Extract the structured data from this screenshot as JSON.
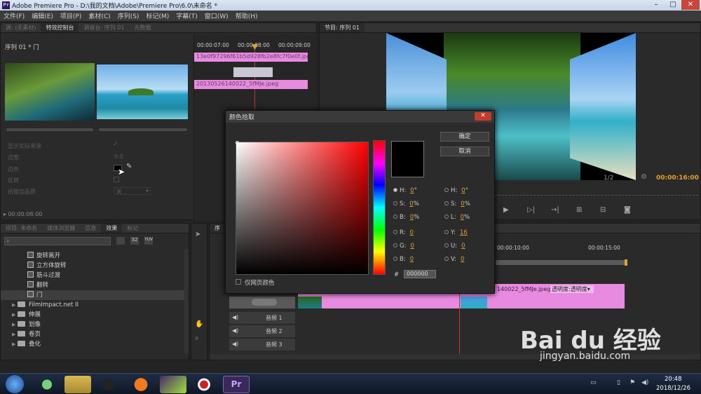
{
  "window": {
    "title": "Adobe Premiere Pro - D:\\我的文档\\Adobe\\Premiere Pro\\6.0\\未命名 *",
    "app_icon_label": "Pr"
  },
  "menu": [
    "文件(F)",
    "编辑(E)",
    "项目(P)",
    "素材(C)",
    "序列(S)",
    "标记(M)",
    "字幕(T)",
    "窗口(W)",
    "帮助(H)"
  ],
  "effect_controls": {
    "tabs": [
      "源: (无素材)",
      "特效控制台",
      "调音台: 序列 01",
      "元数据"
    ],
    "sequence_label": "序列 01 * 门",
    "ruler": [
      "00:00:07:00",
      "00:00:08:00",
      "00:00:09:00"
    ],
    "clip_a": "13e0f97296f61b5d928fb2e8fc7f0e0f.jpg",
    "clip_b": "20130526140022_5fMJe.jpeg",
    "props": [
      {
        "label": "显示实际来源"
      },
      {
        "label": "边宽",
        "value": "0.0"
      },
      {
        "label": "边色"
      },
      {
        "label": "反转"
      },
      {
        "label": "抗锯齿品质",
        "value": "关"
      }
    ],
    "timecode": "00:00:08:00"
  },
  "program_monitor": {
    "tab": "节目: 序列 01",
    "fraction": "1/2",
    "timecode": "00:00:16:00"
  },
  "project_panel": {
    "tabs": [
      "项目: 未命名",
      "媒体浏览器",
      "信息",
      "效果",
      "标记"
    ],
    "effects": [
      {
        "type": "fx",
        "label": "旋转离开"
      },
      {
        "type": "fx",
        "label": "立方体旋转"
      },
      {
        "type": "fx",
        "label": "筋斗过渡"
      },
      {
        "type": "fx",
        "label": "翻转"
      },
      {
        "type": "fx",
        "label": "门",
        "selected": true
      },
      {
        "type": "folder",
        "label": "FilmImpact.net II"
      },
      {
        "type": "folder",
        "label": "伸展"
      },
      {
        "type": "folder",
        "label": "划像"
      },
      {
        "type": "folder",
        "label": "卷页"
      },
      {
        "type": "folder",
        "label": "叠化"
      }
    ]
  },
  "timeline": {
    "tab": "序",
    "ruler": [
      "00:00:10:00",
      "00:00:15:00"
    ],
    "clip_label": "140022_5fMJe.jpeg",
    "clip_opacity": "透明度:透明度",
    "audio_tracks": [
      "音频 1",
      "音频 2",
      "音频 3"
    ]
  },
  "color_picker": {
    "title": "颜色拾取",
    "ok": "确定",
    "cancel": "取消",
    "web_only": "仅网页颜色",
    "hex_label": "#",
    "hex": "000000",
    "left_fields": [
      {
        "label": "H:",
        "value": "0",
        "unit": "°"
      },
      {
        "label": "S:",
        "value": "0",
        "unit": "%"
      },
      {
        "label": "B:",
        "value": "0",
        "unit": "%"
      },
      {
        "label": "R:",
        "value": "0",
        "unit": ""
      },
      {
        "label": "G:",
        "value": "0",
        "unit": ""
      },
      {
        "label": "B:",
        "value": "0",
        "unit": ""
      }
    ],
    "right_fields": [
      {
        "label": "H:",
        "value": "0",
        "unit": "°"
      },
      {
        "label": "S:",
        "value": "0",
        "unit": "%"
      },
      {
        "label": "L:",
        "value": "0",
        "unit": "%"
      },
      {
        "label": "Y:",
        "value": "16",
        "unit": ""
      },
      {
        "label": "U:",
        "value": "0",
        "unit": ""
      },
      {
        "label": "V:",
        "value": "0",
        "unit": ""
      }
    ]
  },
  "taskbar": {
    "time": "20:48",
    "date": "2018/12/26",
    "pr_label": "Pr"
  },
  "watermark": {
    "brand": "Bai du 经验",
    "url": "jingyan.baidu.com"
  }
}
